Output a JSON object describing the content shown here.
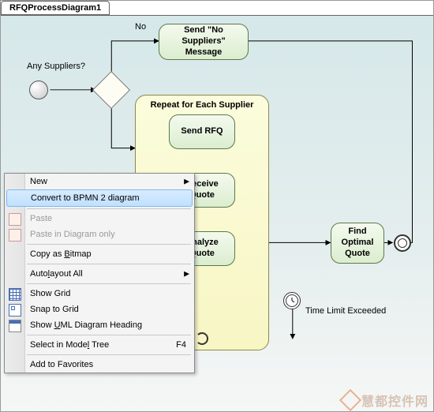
{
  "tab_title": "RFQProcessDiagram1",
  "labels": {
    "any_suppliers": "Any Suppliers?",
    "no": "No",
    "time_limit": "Time Limit Exceeded"
  },
  "tasks": {
    "send_no_suppliers": "Send \"No Suppliers\" Message",
    "find_optimal": "Find Optimal Quote",
    "send_rfq": "Send RFQ",
    "receive_quote": "Receive Quote",
    "analyze_quote": "Analyze Quote"
  },
  "subprocess": {
    "title": "Repeat for Each Supplier"
  },
  "menu": {
    "new": "New",
    "convert": "Convert to BPMN 2 diagram",
    "paste": "Paste",
    "paste_diagram": "Paste in Diagram only",
    "copy_bitmap_pre": "Copy as ",
    "copy_bitmap_u": "B",
    "copy_bitmap_post": "itmap",
    "autolayout_pre": "Auto",
    "autolayout_u": "l",
    "autolayout_post": "ayout All",
    "show_grid": "Show Grid",
    "snap_grid": "Snap to Grid",
    "show_heading_pre": "Show ",
    "show_heading_u": "U",
    "show_heading_post": "ML Diagram Heading",
    "select_tree_pre": "Select in Mode",
    "select_tree_u": "l",
    "select_tree_post": " Tree",
    "select_tree_shortcut": "F4",
    "add_fav": "Add to Favorites"
  },
  "watermark": "慧都控件网"
}
